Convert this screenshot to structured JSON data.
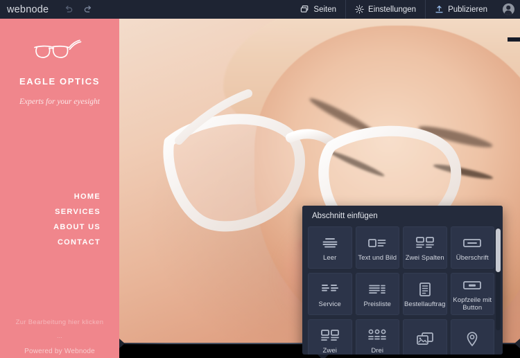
{
  "topbar": {
    "brand": "webnode",
    "undo_icon": "undo-arrow-icon",
    "redo_icon": "redo-arrow-icon",
    "items": [
      {
        "label": "Seiten",
        "icon": "pages-icon"
      },
      {
        "label": "Einstellungen",
        "icon": "gear-icon"
      },
      {
        "label": "Publizieren",
        "icon": "upload-icon"
      }
    ],
    "avatar": "user-avatar-icon",
    "bg_color": "#1e2433"
  },
  "site": {
    "logo_icon": "eyeglasses-icon",
    "title": "EAGLE OPTICS",
    "tagline": "Experts for your eyesight",
    "accent_color": "#f0868c",
    "nav": [
      {
        "label": "HOME"
      },
      {
        "label": "SERVICES"
      },
      {
        "label": "ABOUT US"
      },
      {
        "label": "CONTACT"
      }
    ],
    "footer": {
      "edit_hint": "Zur Bearbeitung hier klicken",
      "dots": "...",
      "powered": "Powered by Webnode"
    }
  },
  "canvas": {
    "add_section_label": "+",
    "hero_image_alt": "woman wearing white eyeglasses close-up"
  },
  "panel": {
    "title": "Abschnitt einfügen",
    "bg_color": "#242b3c",
    "tiles": [
      {
        "label": "Leer",
        "icon": "blank-lines-icon"
      },
      {
        "label": "Text und Bild",
        "icon": "text-and-image-icon"
      },
      {
        "label": "Zwei Spalten",
        "icon": "two-columns-icon"
      },
      {
        "label": "Überschrift",
        "icon": "heading-icon"
      },
      {
        "label": "Service",
        "icon": "service-icon"
      },
      {
        "label": "Preisliste",
        "icon": "pricelist-icon"
      },
      {
        "label": "Bestellauftrag",
        "icon": "order-form-icon"
      },
      {
        "label": "Kopfzeile mit Button",
        "icon": "header-with-button-icon"
      },
      {
        "label": "Zwei",
        "icon": "two-boxes-icon"
      },
      {
        "label": "Drei",
        "icon": "three-dots-grid-icon"
      },
      {
        "label": "",
        "icon": "gallery-icon"
      },
      {
        "label": "",
        "icon": "map-pin-icon"
      }
    ]
  }
}
